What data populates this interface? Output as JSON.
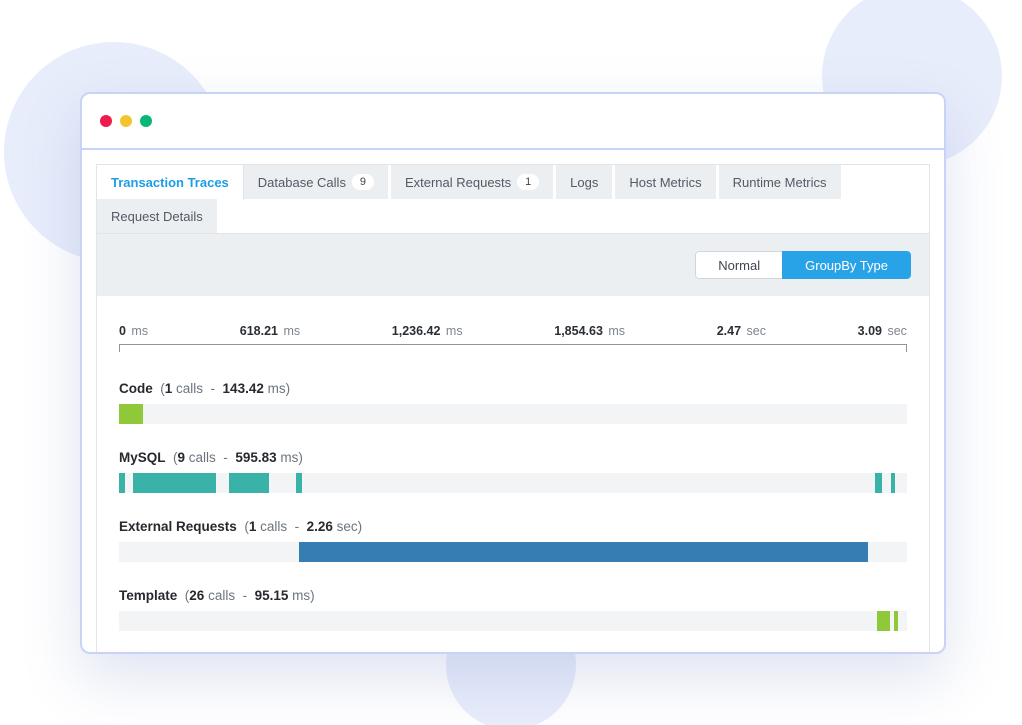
{
  "tabs": [
    {
      "label": "Transaction Traces",
      "badge": "",
      "active": true
    },
    {
      "label": "Database Calls",
      "badge": "9"
    },
    {
      "label": "External Requests",
      "badge": "1"
    },
    {
      "label": "Logs",
      "badge": ""
    },
    {
      "label": "Host Metrics",
      "badge": ""
    },
    {
      "label": "Runtime Metrics",
      "badge": ""
    },
    {
      "label": "Request Details",
      "badge": ""
    }
  ],
  "view_toggle": {
    "normal": "Normal",
    "group_by": "GroupBy Type",
    "active": "group_by"
  },
  "axis": [
    {
      "value": "0",
      "unit": "ms"
    },
    {
      "value": "618.21",
      "unit": "ms"
    },
    {
      "value": "1,236.42",
      "unit": "ms"
    },
    {
      "value": "1,854.63",
      "unit": "ms"
    },
    {
      "value": "2.47",
      "unit": "sec"
    },
    {
      "value": "3.09",
      "unit": "sec"
    }
  ],
  "groups": [
    {
      "name": "Code",
      "calls": "1",
      "duration": "143.42",
      "dur_unit": "ms",
      "color": "c-green",
      "spans": [
        {
          "start_pct": 0,
          "width_pct": 3.1
        }
      ]
    },
    {
      "name": "MySQL",
      "calls": "9",
      "duration": "595.83",
      "dur_unit": "ms",
      "color": "c-teal",
      "spans": [
        {
          "start_pct": 0.0,
          "width_pct": 0.8
        },
        {
          "start_pct": 1.8,
          "width_pct": 10.5
        },
        {
          "start_pct": 14.0,
          "width_pct": 5.0
        },
        {
          "start_pct": 22.4,
          "width_pct": 0.8
        },
        {
          "start_pct": 96.0,
          "width_pct": 0.8
        },
        {
          "start_pct": 98.0,
          "width_pct": 0.5
        }
      ]
    },
    {
      "name": "External Requests",
      "calls": "1",
      "duration": "2.26",
      "dur_unit": "sec",
      "color": "c-blue",
      "spans": [
        {
          "start_pct": 22.8,
          "width_pct": 72.3
        }
      ]
    },
    {
      "name": "Template",
      "calls": "26",
      "duration": "95.15",
      "dur_unit": "ms",
      "color": "c-green",
      "spans": [
        {
          "start_pct": 96.2,
          "width_pct": 1.6
        },
        {
          "start_pct": 98.4,
          "width_pct": 0.4
        }
      ]
    }
  ]
}
